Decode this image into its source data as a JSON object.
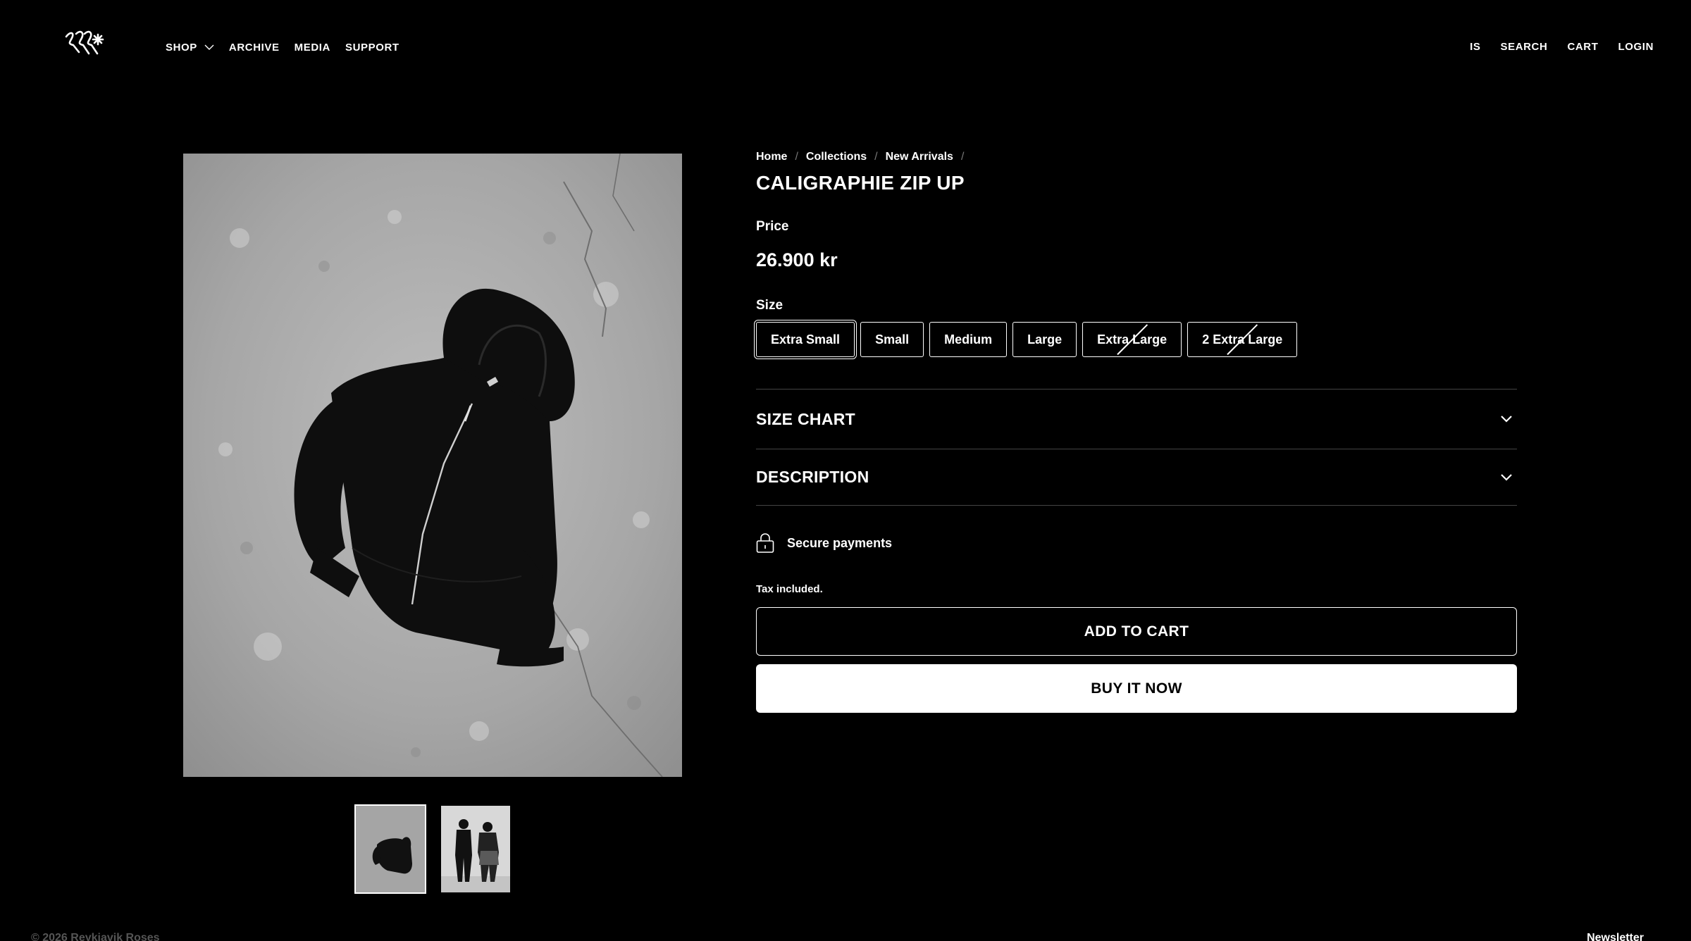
{
  "header": {
    "logo_alt": "Reykjavik Roses logo",
    "nav_left": [
      {
        "label": "SHOP",
        "has_dropdown": true
      },
      {
        "label": "ARCHIVE"
      },
      {
        "label": "MEDIA"
      },
      {
        "label": "SUPPORT"
      }
    ],
    "nav_right": [
      {
        "label": "IS"
      },
      {
        "label": "SEARCH"
      },
      {
        "label": "CART"
      },
      {
        "label": "LOGIN"
      }
    ]
  },
  "gallery": {
    "thumbnails": [
      {
        "label": "hoodie flat lay",
        "active": true
      },
      {
        "label": "two models",
        "active": false
      }
    ]
  },
  "breadcrumb": [
    "Home",
    "Collections",
    "New Arrivals"
  ],
  "product": {
    "title": "CALIGRAPHIE ZIP UP",
    "price_label": "Price",
    "price": "26.900 kr",
    "size_label": "Size",
    "sizes": [
      {
        "label": "Extra Small",
        "selected": true,
        "available": true
      },
      {
        "label": "Small",
        "selected": false,
        "available": true
      },
      {
        "label": "Medium",
        "selected": false,
        "available": true
      },
      {
        "label": "Large",
        "selected": false,
        "available": true
      },
      {
        "label": "Extra Large",
        "selected": false,
        "available": false
      },
      {
        "label": "2 Extra Large",
        "selected": false,
        "available": false
      }
    ]
  },
  "accordion": [
    {
      "title": "SIZE CHART"
    },
    {
      "title": "DESCRIPTION"
    }
  ],
  "secure_payments": "Secure payments",
  "tax_note": "Tax included.",
  "buttons": {
    "add_to_cart": "ADD TO CART",
    "buy_now": "BUY IT NOW"
  },
  "footer": {
    "copyright": "© 2026 Reykjavik Roses",
    "newsletter": "Newsletter"
  },
  "colors": {
    "background": "#000000",
    "text": "#ffffff",
    "divider": "#444444"
  }
}
